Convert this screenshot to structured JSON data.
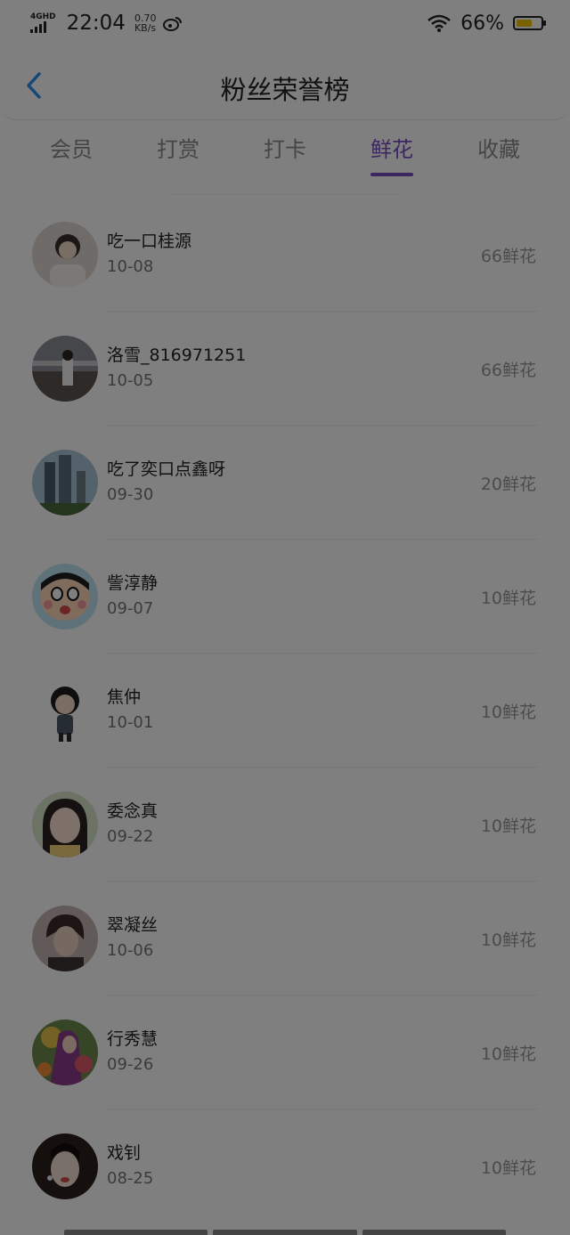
{
  "status": {
    "net": "4GHD",
    "time": "22:04",
    "speed_value": "0.70",
    "speed_unit": "KB/s",
    "battery": "66%",
    "battery_level": 0.66
  },
  "header": {
    "title": "粉丝荣誉榜"
  },
  "tabs": [
    {
      "label": "会员",
      "active": false
    },
    {
      "label": "打赏",
      "active": false
    },
    {
      "label": "打卡",
      "active": false
    },
    {
      "label": "鲜花",
      "active": true
    },
    {
      "label": "收藏",
      "active": false
    }
  ],
  "list": [
    {
      "name": "吃一口桂源",
      "date": "10-08",
      "count": "66鲜花"
    },
    {
      "name": "洛雪_816971251",
      "date": "10-05",
      "count": "66鲜花"
    },
    {
      "name": "吃了奕口点鑫呀",
      "date": "09-30",
      "count": "20鲜花"
    },
    {
      "name": "訾淳静",
      "date": "09-07",
      "count": "10鲜花"
    },
    {
      "name": "焦仲",
      "date": "10-01",
      "count": "10鲜花"
    },
    {
      "name": "委念真",
      "date": "09-22",
      "count": "10鲜花"
    },
    {
      "name": "翠凝丝",
      "date": "10-06",
      "count": "10鲜花"
    },
    {
      "name": "行秀慧",
      "date": "09-26",
      "count": "10鲜花"
    },
    {
      "name": "戏钊",
      "date": "08-25",
      "count": "10鲜花"
    }
  ],
  "colors": {
    "accent": "#7b4fc2",
    "back": "#2a8fe8",
    "overlay": "rgba(0,0,0,0.5)"
  }
}
